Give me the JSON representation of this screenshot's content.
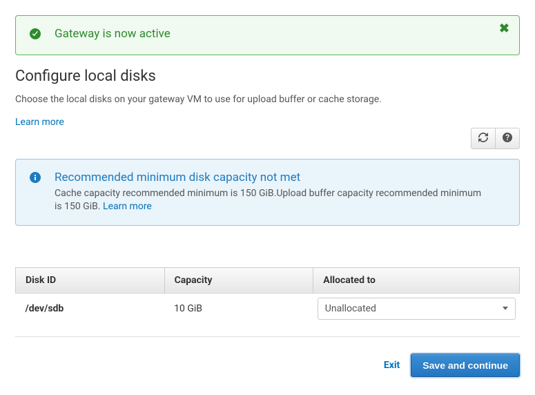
{
  "alerts": {
    "success": {
      "title": "Gateway is now active"
    },
    "info": {
      "title": "Recommended minimum disk capacity not met",
      "text": "Cache capacity recommended minimum is 150 GiB.Upload buffer capacity recommended minimum is 150 GiB.",
      "learn_more": "Learn more"
    }
  },
  "page": {
    "title": "Configure local disks",
    "description": "Choose the local disks on your gateway VM to use for upload buffer or cache storage.",
    "learn_more": "Learn more"
  },
  "table": {
    "headers": {
      "disk_id": "Disk ID",
      "capacity": "Capacity",
      "allocated_to": "Allocated to"
    },
    "rows": [
      {
        "disk_id": "/dev/sdb",
        "capacity": "10 GiB",
        "allocated_to": "Unallocated"
      }
    ]
  },
  "actions": {
    "exit": "Exit",
    "save": "Save and continue"
  }
}
